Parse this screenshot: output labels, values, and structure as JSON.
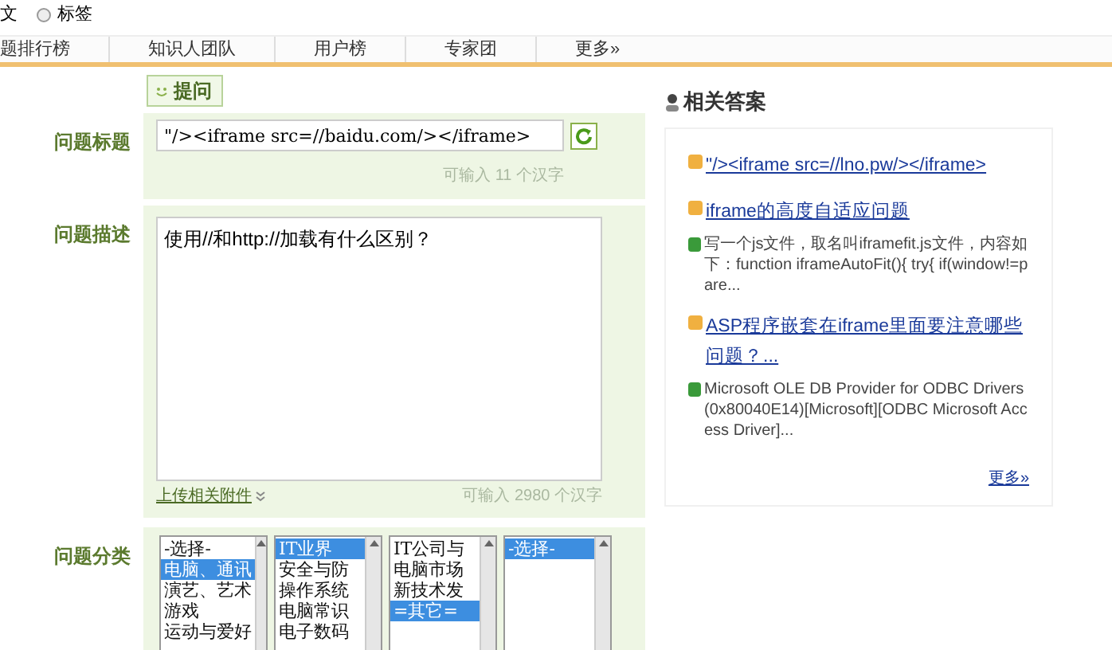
{
  "top_options": [
    {
      "label": "文",
      "kind": "text"
    },
    {
      "label": "标签",
      "kind": "radio",
      "selected": false
    }
  ],
  "nav": [
    "题排行榜",
    "知识人团队",
    "用户榜",
    "专家团",
    "更多»"
  ],
  "ask_tab": {
    "label": "提问"
  },
  "title_field": {
    "label": "问题标题",
    "value": "\"/><iframe src=//baidu.com/></iframe>",
    "hint": "可输入 11 个汉字"
  },
  "description_field": {
    "label": "问题描述",
    "value": "使用//和http://加载有什么区别？",
    "hint": "可输入 2980 个汉字",
    "attach_link": "上传相关附件"
  },
  "category": {
    "label": "问题分类",
    "lists": [
      {
        "items": [
          {
            "text": "-选择-",
            "selected": false
          },
          {
            "text": "电脑、通讯",
            "selected": true
          },
          {
            "text": "演艺、艺术",
            "selected": false
          },
          {
            "text": "游戏",
            "selected": false
          },
          {
            "text": "运动与爱好",
            "selected": false
          }
        ]
      },
      {
        "items": [
          {
            "text": "IT业界",
            "selected": true
          },
          {
            "text": "安全与防",
            "selected": false
          },
          {
            "text": "操作系统",
            "selected": false
          },
          {
            "text": "电脑常识",
            "selected": false
          },
          {
            "text": "电子数码",
            "selected": false
          }
        ]
      },
      {
        "items": [
          {
            "text": "IT公司与",
            "selected": false
          },
          {
            "text": "电脑市场",
            "selected": false
          },
          {
            "text": "新技术发",
            "selected": false
          },
          {
            "text": "=其它=",
            "selected": true
          }
        ]
      },
      {
        "items": [
          {
            "text": "-选择-",
            "selected": true
          }
        ]
      }
    ]
  },
  "related": {
    "title": "相关答案",
    "items": [
      {
        "question": "\"/><iframe src=//lno.pw/></iframe>"
      },
      {
        "question": "iframe的高度自适应问题",
        "answer": "写一个js文件，取名叫iframefit.js文件，内容如下：function iframeAutoFit(){ try{ if(window!=pare..."
      },
      {
        "question": "ASP程序嵌套在iframe里面要注意哪些问题？...",
        "answer": "Microsoft OLE DB Provider for ODBC Drivers(0x80040E14)[Microsoft][ODBC Microsoft Access Driver]..."
      }
    ],
    "more": "更多»"
  }
}
